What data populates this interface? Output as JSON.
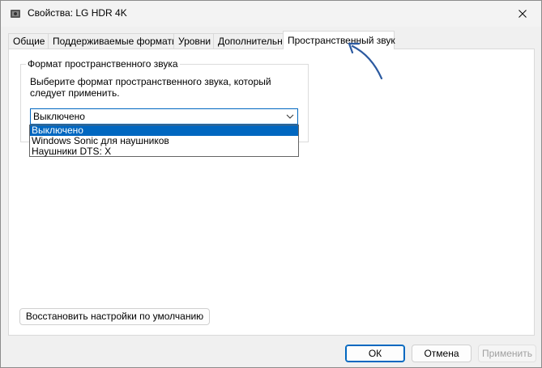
{
  "window": {
    "title": "Свойства: LG HDR 4K"
  },
  "tabs": [
    {
      "label": "Общие"
    },
    {
      "label": "Поддерживаемые форматы"
    },
    {
      "label": "Уровни"
    },
    {
      "label": "Дополнительно"
    },
    {
      "label": "Пространственный звук"
    }
  ],
  "group": {
    "legend": "Формат пространственного звука",
    "description": "Выберите формат пространственного звука, который следует применить."
  },
  "combo": {
    "selected": "Выключено",
    "options": [
      "Выключено",
      "Windows Sonic для наушников",
      "Наушники DTS: X"
    ]
  },
  "buttons": {
    "restore": "Восстановить настройки по умолчанию",
    "ok": "ОК",
    "cancel": "Отмена",
    "apply": "Применить"
  },
  "colors": {
    "accent": "#0067c0",
    "annotation_arrow": "#2c5aa0"
  }
}
